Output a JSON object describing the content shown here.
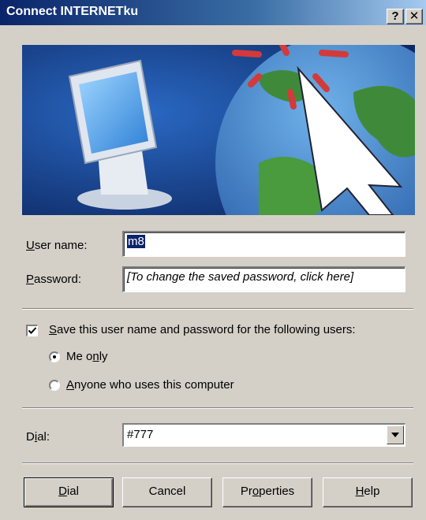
{
  "window": {
    "title": "Connect INTERNETku",
    "help_glyph": "?",
    "close_glyph": "✕"
  },
  "form": {
    "user_label_hotkey": "U",
    "user_label_rest": "ser name:",
    "user_value": "m8",
    "password_label_hotkey": "P",
    "password_label_rest": "assword:",
    "password_value": "[To change the saved password, click here]",
    "save_checked": true,
    "save_label_hotkey": "S",
    "save_label_rest": "ave this user name and password for the following users:",
    "radio_me_pre": "Me o",
    "radio_me_hotkey": "n",
    "radio_me_post": "ly",
    "radio_me_selected": true,
    "radio_anyone_hotkey": "A",
    "radio_anyone_rest": "nyone who uses this computer",
    "dial_label_pre": "D",
    "dial_label_hotkey": "i",
    "dial_label_post": "al:",
    "dial_value": "#777"
  },
  "buttons": {
    "dial_hotkey": "D",
    "dial_rest": "ial",
    "cancel": "Cancel",
    "properties_pre": "Pr",
    "properties_hotkey": "o",
    "properties_post": "perties",
    "help_hotkey": "H",
    "help_rest": "elp"
  },
  "icons": {
    "banner": "computer-globe-cursor-illustration",
    "dropdown": "chevron-down-icon",
    "check": "checkmark-icon"
  }
}
